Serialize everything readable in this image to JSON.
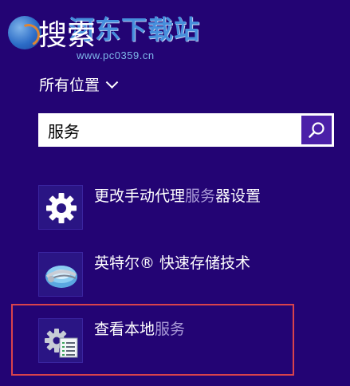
{
  "watermark": {
    "title": "河东下载站",
    "url": "www.pc0359.cn"
  },
  "header": {
    "title": "搜索"
  },
  "scope": {
    "label": "所有位置"
  },
  "search": {
    "value": "服务"
  },
  "results": [
    {
      "label_prefix": "更改手动代理",
      "label_match": "服务",
      "label_suffix": "器设置",
      "icon": "gear-icon"
    },
    {
      "label_prefix": "英特尔® 快速存储技术",
      "label_match": "",
      "label_suffix": "",
      "icon": "intel-rst-icon"
    },
    {
      "label_prefix": "查看本地",
      "label_match": "服务",
      "label_suffix": "",
      "icon": "services-icon"
    }
  ],
  "colors": {
    "background": "#230474",
    "search_button": "#4b20a8",
    "highlight_frame": "#d9434c",
    "match_text": "#a99ad6"
  }
}
